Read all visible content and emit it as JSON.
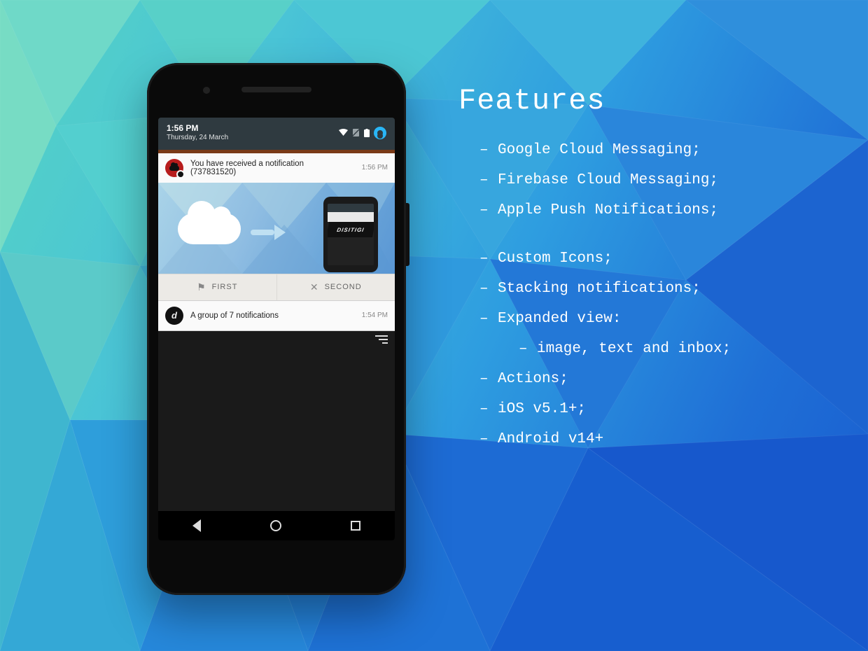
{
  "statusbar": {
    "time": "1:56 PM",
    "date": "Thursday, 24 March"
  },
  "notification1": {
    "title": "You have received a notification (737831520)",
    "time": "1:56 PM",
    "actions": {
      "first": "FIRST",
      "second": "SECOND"
    },
    "mini_logo": "DISITIGI"
  },
  "notification2": {
    "title": "A group of 7 notifications",
    "time": "1:54 PM"
  },
  "features": {
    "heading": "Features",
    "items": [
      "Google Cloud Messaging;",
      "Firebase Cloud Messaging;",
      "Apple Push Notifications;",
      "Custom Icons;",
      "Stacking notifications;",
      "Expanded view:",
      "image, text and inbox;",
      "Actions;",
      "iOS v5.1+;",
      "Android v14+"
    ]
  }
}
